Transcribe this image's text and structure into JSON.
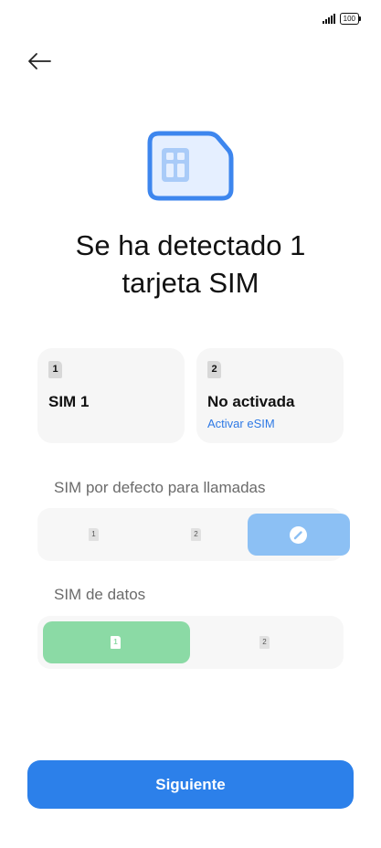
{
  "status_bar": {
    "battery": "100"
  },
  "header": {
    "back_icon": "arrow-left-icon"
  },
  "illustration": {
    "icon": "sim-card-icon",
    "color": "#3d86ee"
  },
  "title": {
    "line1": "Se ha detectado 1",
    "line2": "tarjeta SIM"
  },
  "sim_cards": [
    {
      "badge": "1",
      "name": "SIM 1",
      "link": ""
    },
    {
      "badge": "2",
      "name": "No activada",
      "link": "Activar eSIM"
    }
  ],
  "calls_section": {
    "label": "SIM por defecto para llamadas",
    "options": [
      "1",
      "2"
    ],
    "selected_icon": "pencil-icon"
  },
  "data_section": {
    "label": "SIM de datos",
    "options": [
      "1",
      "2"
    ],
    "selected": "1"
  },
  "footer": {
    "next_label": "Siguiente"
  },
  "colors": {
    "accent": "#2c80ea",
    "calls_selected": "#8cc0f4",
    "data_selected": "#8bdaa5",
    "link": "#2f7ae5"
  }
}
